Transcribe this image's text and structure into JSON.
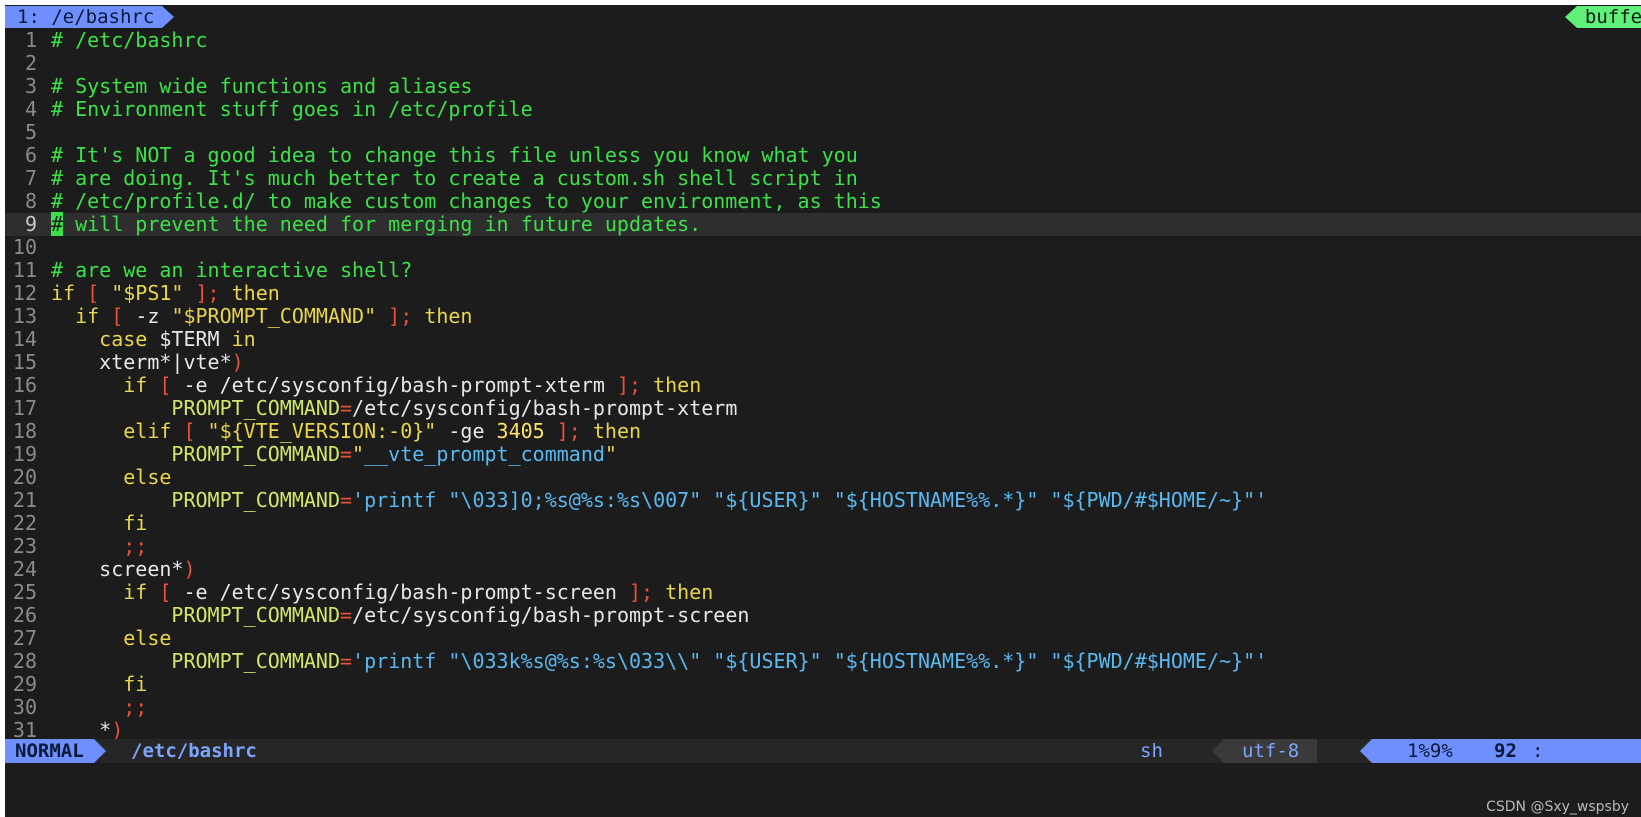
{
  "tabline": {
    "active_tab": "1: /e/bashrc",
    "buffers_label": "buffers"
  },
  "lines": [
    {
      "n": "1",
      "segs": [
        {
          "c": "comment",
          "t": "# /etc/bashrc"
        }
      ]
    },
    {
      "n": "2",
      "segs": []
    },
    {
      "n": "3",
      "segs": [
        {
          "c": "comment",
          "t": "# System wide functions and aliases"
        }
      ]
    },
    {
      "n": "4",
      "segs": [
        {
          "c": "comment",
          "t": "# Environment stuff goes in /etc/profile"
        }
      ]
    },
    {
      "n": "5",
      "segs": []
    },
    {
      "n": "6",
      "segs": [
        {
          "c": "comment",
          "t": "# It's NOT a good idea to change this file unless you know what you"
        }
      ]
    },
    {
      "n": "7",
      "segs": [
        {
          "c": "comment",
          "t": "# are doing. It's much better to create a custom.sh shell script in"
        }
      ]
    },
    {
      "n": "8",
      "segs": [
        {
          "c": "comment",
          "t": "# /etc/profile.d/ to make custom changes to your environment, as this"
        }
      ]
    },
    {
      "n": "9",
      "cursorline": true,
      "segs": [
        {
          "c": "cursor",
          "t": "#"
        },
        {
          "c": "comment",
          "t": " will prevent the need for merging in future updates."
        }
      ]
    },
    {
      "n": "10",
      "segs": []
    },
    {
      "n": "11",
      "segs": [
        {
          "c": "comment",
          "t": "# are we an interactive shell?"
        }
      ]
    },
    {
      "n": "12",
      "segs": [
        {
          "c": "kw",
          "t": "if"
        },
        {
          "c": "op",
          "t": " [ "
        },
        {
          "c": "str",
          "t": "\"$PS1\""
        },
        {
          "c": "op",
          "t": " ]; "
        },
        {
          "c": "kw",
          "t": "then"
        }
      ]
    },
    {
      "n": "13",
      "segs": [
        {
          "c": "plain",
          "t": "  "
        },
        {
          "c": "kw",
          "t": "if"
        },
        {
          "c": "op",
          "t": " [ "
        },
        {
          "c": "plain",
          "t": "-z "
        },
        {
          "c": "str",
          "t": "\"$PROMPT_COMMAND\""
        },
        {
          "c": "op",
          "t": " ]; "
        },
        {
          "c": "kw",
          "t": "then"
        }
      ]
    },
    {
      "n": "14",
      "segs": [
        {
          "c": "plain",
          "t": "    "
        },
        {
          "c": "kw",
          "t": "case"
        },
        {
          "c": "plain",
          "t": " $TERM "
        },
        {
          "c": "kw",
          "t": "in"
        }
      ]
    },
    {
      "n": "15",
      "segs": [
        {
          "c": "plain",
          "t": "    xterm*|vte*"
        },
        {
          "c": "op",
          "t": ")"
        }
      ]
    },
    {
      "n": "16",
      "segs": [
        {
          "c": "plain",
          "t": "      "
        },
        {
          "c": "kw",
          "t": "if"
        },
        {
          "c": "op",
          "t": " [ "
        },
        {
          "c": "plain",
          "t": "-e /etc/sysconfig/bash-prompt-xterm "
        },
        {
          "c": "op",
          "t": "]; "
        },
        {
          "c": "kw",
          "t": "then"
        }
      ]
    },
    {
      "n": "17",
      "segs": [
        {
          "c": "plain",
          "t": "          "
        },
        {
          "c": "assign",
          "t": "PROMPT_COMMAND"
        },
        {
          "c": "op",
          "t": "="
        },
        {
          "c": "plain",
          "t": "/etc/sysconfig/bash-prompt-xterm"
        }
      ]
    },
    {
      "n": "18",
      "segs": [
        {
          "c": "plain",
          "t": "      "
        },
        {
          "c": "kw",
          "t": "elif"
        },
        {
          "c": "op",
          "t": " [ "
        },
        {
          "c": "str",
          "t": "\"${VTE_VERSION:-0}\""
        },
        {
          "c": "plain",
          "t": " -ge "
        },
        {
          "c": "num",
          "t": "3405"
        },
        {
          "c": "op",
          "t": " ]; "
        },
        {
          "c": "kw",
          "t": "then"
        }
      ]
    },
    {
      "n": "19",
      "segs": [
        {
          "c": "plain",
          "t": "          "
        },
        {
          "c": "assign",
          "t": "PROMPT_COMMAND"
        },
        {
          "c": "op",
          "t": "="
        },
        {
          "c": "str",
          "t": "\""
        },
        {
          "c": "sq",
          "t": "__vte_prompt_command"
        },
        {
          "c": "str",
          "t": "\""
        }
      ]
    },
    {
      "n": "20",
      "segs": [
        {
          "c": "plain",
          "t": "      "
        },
        {
          "c": "kw",
          "t": "else"
        }
      ]
    },
    {
      "n": "21",
      "segs": [
        {
          "c": "plain",
          "t": "          "
        },
        {
          "c": "assign",
          "t": "PROMPT_COMMAND"
        },
        {
          "c": "op",
          "t": "="
        },
        {
          "c": "sq",
          "t": "'printf \"\\033]0;%s@%s:%s\\007\" \"${USER}\" \"${HOSTNAME%%.*}\" \"${PWD/#$HOME/~}\"'"
        }
      ]
    },
    {
      "n": "22",
      "segs": [
        {
          "c": "plain",
          "t": "      "
        },
        {
          "c": "kw",
          "t": "fi"
        }
      ]
    },
    {
      "n": "23",
      "segs": [
        {
          "c": "plain",
          "t": "      "
        },
        {
          "c": "op",
          "t": ";;"
        }
      ]
    },
    {
      "n": "24",
      "segs": [
        {
          "c": "plain",
          "t": "    screen*"
        },
        {
          "c": "op",
          "t": ")"
        }
      ]
    },
    {
      "n": "25",
      "segs": [
        {
          "c": "plain",
          "t": "      "
        },
        {
          "c": "kw",
          "t": "if"
        },
        {
          "c": "op",
          "t": " [ "
        },
        {
          "c": "plain",
          "t": "-e /etc/sysconfig/bash-prompt-screen "
        },
        {
          "c": "op",
          "t": "]; "
        },
        {
          "c": "kw",
          "t": "then"
        }
      ]
    },
    {
      "n": "26",
      "segs": [
        {
          "c": "plain",
          "t": "          "
        },
        {
          "c": "assign",
          "t": "PROMPT_COMMAND"
        },
        {
          "c": "op",
          "t": "="
        },
        {
          "c": "plain",
          "t": "/etc/sysconfig/bash-prompt-screen"
        }
      ]
    },
    {
      "n": "27",
      "segs": [
        {
          "c": "plain",
          "t": "      "
        },
        {
          "c": "kw",
          "t": "else"
        }
      ]
    },
    {
      "n": "28",
      "segs": [
        {
          "c": "plain",
          "t": "          "
        },
        {
          "c": "assign",
          "t": "PROMPT_COMMAND"
        },
        {
          "c": "op",
          "t": "="
        },
        {
          "c": "sq",
          "t": "'printf \"\\033k%s@%s:%s\\033\\\\\" \"${USER}\" \"${HOSTNAME%%.*}\" \"${PWD/#$HOME/~}\"'"
        }
      ]
    },
    {
      "n": "29",
      "segs": [
        {
          "c": "plain",
          "t": "      "
        },
        {
          "c": "kw",
          "t": "fi"
        }
      ]
    },
    {
      "n": "30",
      "segs": [
        {
          "c": "plain",
          "t": "      "
        },
        {
          "c": "op",
          "t": ";;"
        }
      ]
    },
    {
      "n": "31",
      "segs": [
        {
          "c": "plain",
          "t": "    *"
        },
        {
          "c": "op",
          "t": ")"
        }
      ]
    }
  ],
  "statusline": {
    "mode": "NORMAL",
    "file": "/etc/bashrc",
    "filetype": "sh",
    "encoding": "utf-8",
    "percent": "1%9%",
    "line": "92",
    "col_sep": ":"
  },
  "watermark": "CSDN @Sxy_wspsby"
}
